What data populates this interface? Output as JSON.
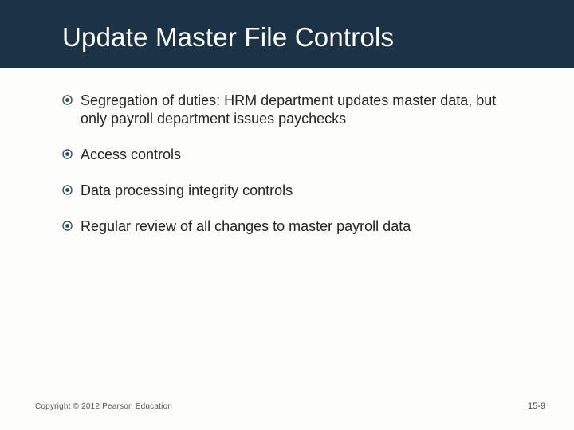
{
  "title": "Update Master File Controls",
  "bullets": [
    "Segregation of duties: HRM department updates master data, but only payroll department issues paychecks",
    "Access controls",
    "Data processing integrity controls",
    "Regular review of all changes to master payroll data"
  ],
  "footer_left": "Copyright © 2012 Pearson Education",
  "footer_right": "15-9"
}
